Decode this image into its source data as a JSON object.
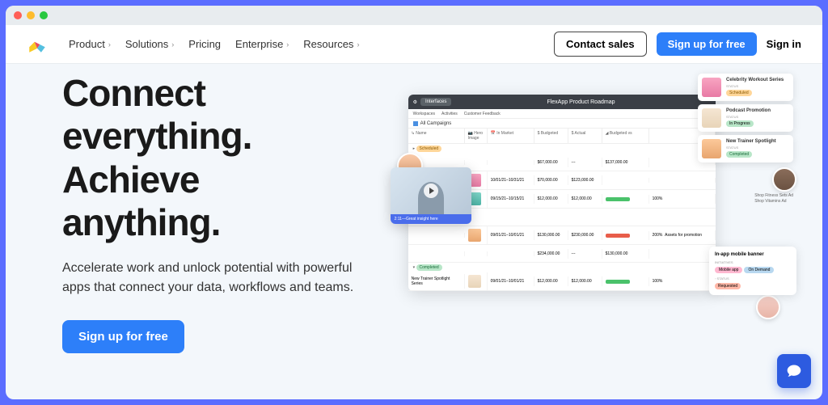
{
  "nav": {
    "items": [
      "Product",
      "Solutions",
      "Pricing",
      "Enterprise",
      "Resources"
    ],
    "contact": "Contact sales",
    "signup": "Sign up for free",
    "signin": "Sign in"
  },
  "hero": {
    "title_l1": "Connect",
    "title_l2": "everything.",
    "title_l3": "Achieve",
    "title_l4": "anything.",
    "sub": "Accelerate work and unlock potential with powerful apps that connect your data, workflows and teams.",
    "cta": "Sign up for free"
  },
  "mock": {
    "base_tab": "Interfaces",
    "tabs": [
      "Workspaces",
      "Activities",
      "Customer Feedback"
    ],
    "app_title": "FlexApp Product Roadmap",
    "view": "All Campaigns",
    "cols": [
      "Name",
      "Hero Image",
      "In Market",
      "Budgeted",
      "Actual",
      "Budgeted vs"
    ],
    "section1": "Scheduled",
    "section2": "Completed",
    "rows": [
      {
        "name": "",
        "dates": "",
        "b": "$67,000.00",
        "a": "---",
        "c": "$137,000.00"
      },
      {
        "name": "Celebrity Workout Series",
        "dates": "10/01/21–10/31/21",
        "b": "$70,000.00",
        "a": "$123,000.00"
      },
      {
        "name": "",
        "dates": "09/15/21–10/15/21",
        "b": "$12,000.00",
        "a": "$12,000.00",
        "pct": "100%"
      },
      {
        "name": "",
        "dates": "09/01/21–10/01/21",
        "b": "$130,000.00",
        "a": "$230,000.00",
        "pct": "200%",
        "note": "Assets for promotion"
      },
      {
        "name": "",
        "dates": "",
        "b": "$234,000.00",
        "a": "---",
        "c": "$130,000.00"
      },
      {
        "name": "New Trainer Spotlight Series",
        "dates": "09/01/21–10/01/21",
        "b": "$12,000.00",
        "a": "$12,000.00",
        "pct": "100%"
      }
    ]
  },
  "fcards": [
    {
      "title": "Celebrity Workout Series",
      "status": "Scheduled",
      "cls": "sched",
      "thumb": "pink"
    },
    {
      "title": "Podcast Promotion",
      "status": "In Progress",
      "cls": "inprog",
      "thumb": "cream"
    },
    {
      "title": "New Trainer Spotlight",
      "status": "Completed",
      "cls": "comp",
      "thumb": "peach"
    }
  ],
  "side_lines": {
    "l1": "Shop Fitness Sets Ad",
    "l2": "Shop Vitamins Ad"
  },
  "video_caption": "2:11—Great insight here",
  "detail": {
    "title": "In-app mobile banner",
    "label1": "INITIATIVES",
    "tag1": "Mobile app",
    "tag2": "On Demand",
    "label2": "STATUS",
    "status": "Requested"
  },
  "status_word": "STATUS"
}
